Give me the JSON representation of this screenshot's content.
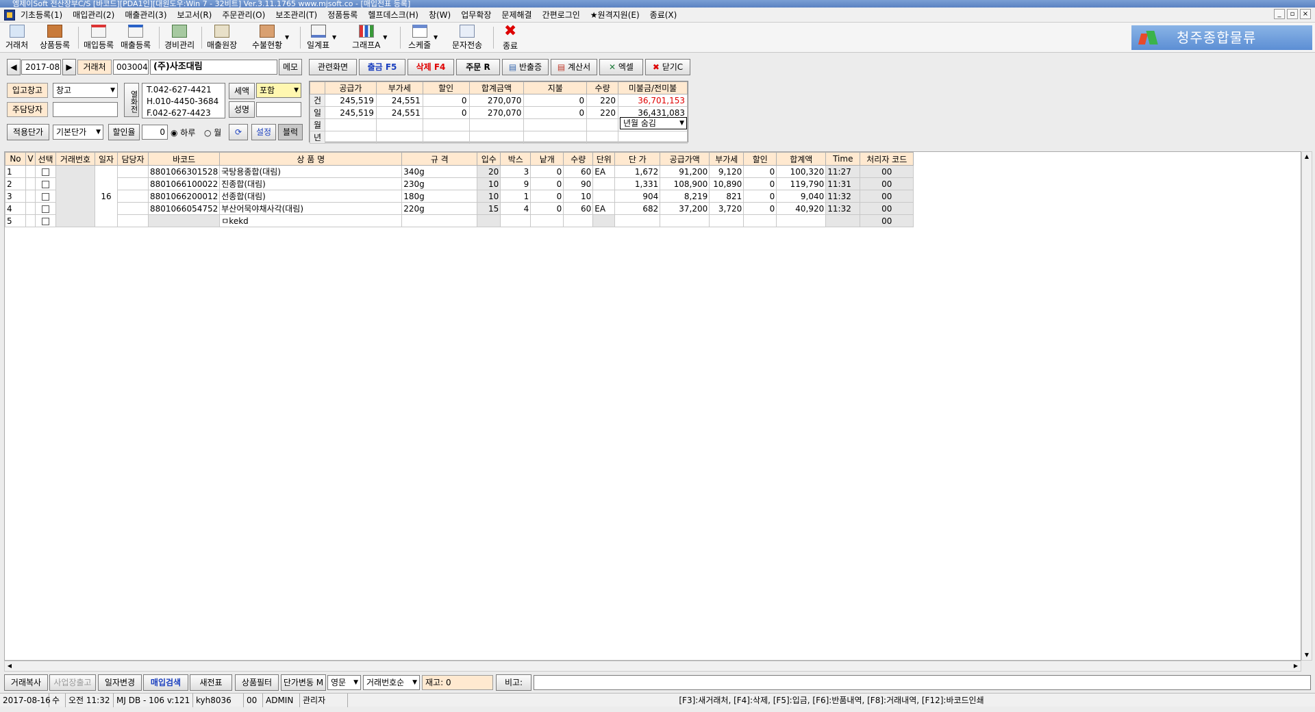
{
  "window": {
    "title": "엠제이Soft 전산장부C/S [바코드][PDA1인][대원도우:Win 7 - 32비트] Ver.3.11.1765            www.mjsoft.co - [매입전표 등록]",
    "controls": [
      "_",
      "▫",
      "×"
    ]
  },
  "menu": {
    "items": [
      "기초등록(1)",
      "매입관리(2)",
      "매출관리(3)",
      "보고서(R)",
      "주문관리(O)",
      "보조관리(T)",
      "정품등록",
      "헬프데스크(H)",
      "창(W)",
      "업무확장",
      "문제해결",
      "간편로그인",
      "★원격지원(E)",
      "종료(X)"
    ]
  },
  "toolbar": {
    "items": [
      "거래처",
      "상품등록",
      "매입등록",
      "매출등록",
      "경비관리",
      "매출원장",
      "수불현황",
      "일계표",
      "그래프A",
      "스케줄",
      "문자전송",
      "종료"
    ],
    "brand": "청주종합물류"
  },
  "form": {
    "prev": "◀",
    "period": "2017-08",
    "next": "▶",
    "partner_label": "거래처",
    "partner_code": "003004",
    "partner_name": "(주)사조대림",
    "memo": "메모",
    "warehouse_label": "입고창고",
    "warehouse_value": "창고",
    "manager_label": "주담당자",
    "manager_value": "",
    "phone_btn": "열화전",
    "tel": "T.042-627-4421",
    "hp": "H.010-4450-3684",
    "fax": "F.042-627-4423",
    "tax_label": "세액",
    "tax_value": "포함",
    "name_btn": "성명",
    "name_value": "",
    "price_label": "적용단가",
    "price_value": "기본단가",
    "discount_label": "할인율",
    "discount_value": "0",
    "radio_day": "하루",
    "radio_month": "월",
    "settings_btn": "설정",
    "block_btn": "블럭"
  },
  "actions": {
    "related": "관련화면",
    "out": "출금 F5",
    "delete": "삭제 F4",
    "order": "주문 R",
    "return": "반출증",
    "invoice": "계산서",
    "excel": "엑셀",
    "close": "닫기C"
  },
  "summary": {
    "headers": [
      "공급가",
      "부가세",
      "할인",
      "합계금액",
      "지불",
      "수량",
      "미불금/전미불"
    ],
    "side": [
      "건",
      "일",
      "월",
      "년"
    ],
    "rows": [
      [
        "245,519",
        "24,551",
        "0",
        "270,070",
        "0",
        "220",
        "36,701,153"
      ],
      [
        "245,519",
        "24,551",
        "0",
        "270,070",
        "0",
        "220",
        "36,431,083"
      ]
    ],
    "select": "년월 숨김"
  },
  "grid": {
    "headers": [
      "No",
      "V",
      "선택",
      "거래번호",
      "일자",
      "담당자",
      "바코드",
      "상 품 명",
      "규 격",
      "입수",
      "박스",
      "낱개",
      "수량",
      "단위",
      "단 가",
      "공급가액",
      "부가세",
      "할인",
      "합계액",
      "Time",
      "처리자 코드"
    ],
    "day": "16",
    "rows": [
      {
        "no": "1",
        "barcode": "8801066301528",
        "name": "국탕용종합(대림)",
        "spec": "340g",
        "ipsu": "20",
        "box": "3",
        "each": "0",
        "qty": "60",
        "unit": "EA",
        "price": "1,672",
        "supply": "91,200",
        "vat": "9,120",
        "disc": "0",
        "total": "100,320",
        "time": "11:27",
        "code": "00"
      },
      {
        "no": "2",
        "barcode": "8801066100022",
        "name": "진종합(대림)",
        "spec": "230g",
        "ipsu": "10",
        "box": "9",
        "each": "0",
        "qty": "90",
        "unit": "",
        "price": "1,331",
        "supply": "108,900",
        "vat": "10,890",
        "disc": "0",
        "total": "119,790",
        "time": "11:31",
        "code": "00"
      },
      {
        "no": "3",
        "barcode": "8801066200012",
        "name": "선종합(대림)",
        "spec": "180g",
        "ipsu": "10",
        "box": "1",
        "each": "0",
        "qty": "10",
        "unit": "",
        "price": "904",
        "supply": "8,219",
        "vat": "821",
        "disc": "0",
        "total": "9,040",
        "time": "11:32",
        "code": "00"
      },
      {
        "no": "4",
        "barcode": "8801066054752",
        "name": "부산어묵야채사각(대림)",
        "spec": "220g",
        "ipsu": "15",
        "box": "4",
        "each": "0",
        "qty": "60",
        "unit": "EA",
        "price": "682",
        "supply": "37,200",
        "vat": "3,720",
        "disc": "0",
        "total": "40,920",
        "time": "11:32",
        "code": "00"
      },
      {
        "no": "5",
        "barcode": "",
        "name": "ㅁkekd",
        "spec": "",
        "ipsu": "",
        "box": "",
        "each": "",
        "qty": "",
        "unit": "",
        "price": "",
        "supply": "",
        "vat": "",
        "disc": "",
        "total": "",
        "time": "",
        "code": "00"
      }
    ]
  },
  "bottom": {
    "copy": "거래복사",
    "biz": "사업장출고",
    "date_change": "일자변경",
    "search": "매입검색",
    "new_slip": "새전표",
    "filter": "상품필터",
    "price_change": "단가변동 M",
    "lang": "영문",
    "sort": "거래번호순",
    "stock": "재고: 0",
    "note_label": "비고:",
    "note_value": ""
  },
  "status": {
    "date": "2017-08-16",
    "weekday": "수",
    "time": "오전 11:32",
    "db": "MJ DB - 106 v:121",
    "user": "kyh8036",
    "code": "00",
    "role": "ADMIN",
    "role2": "관리자",
    "hotkeys": "[F3]:새거래처, [F4]:삭제, [F5]:입금, [F6]:반품내역, [F8]:거래내역, [F12]:바코드인쇄"
  },
  "colors": {
    "header_bg": "#ffe9d0",
    "danger": "#e00000",
    "accent": "#1a3fbf"
  }
}
